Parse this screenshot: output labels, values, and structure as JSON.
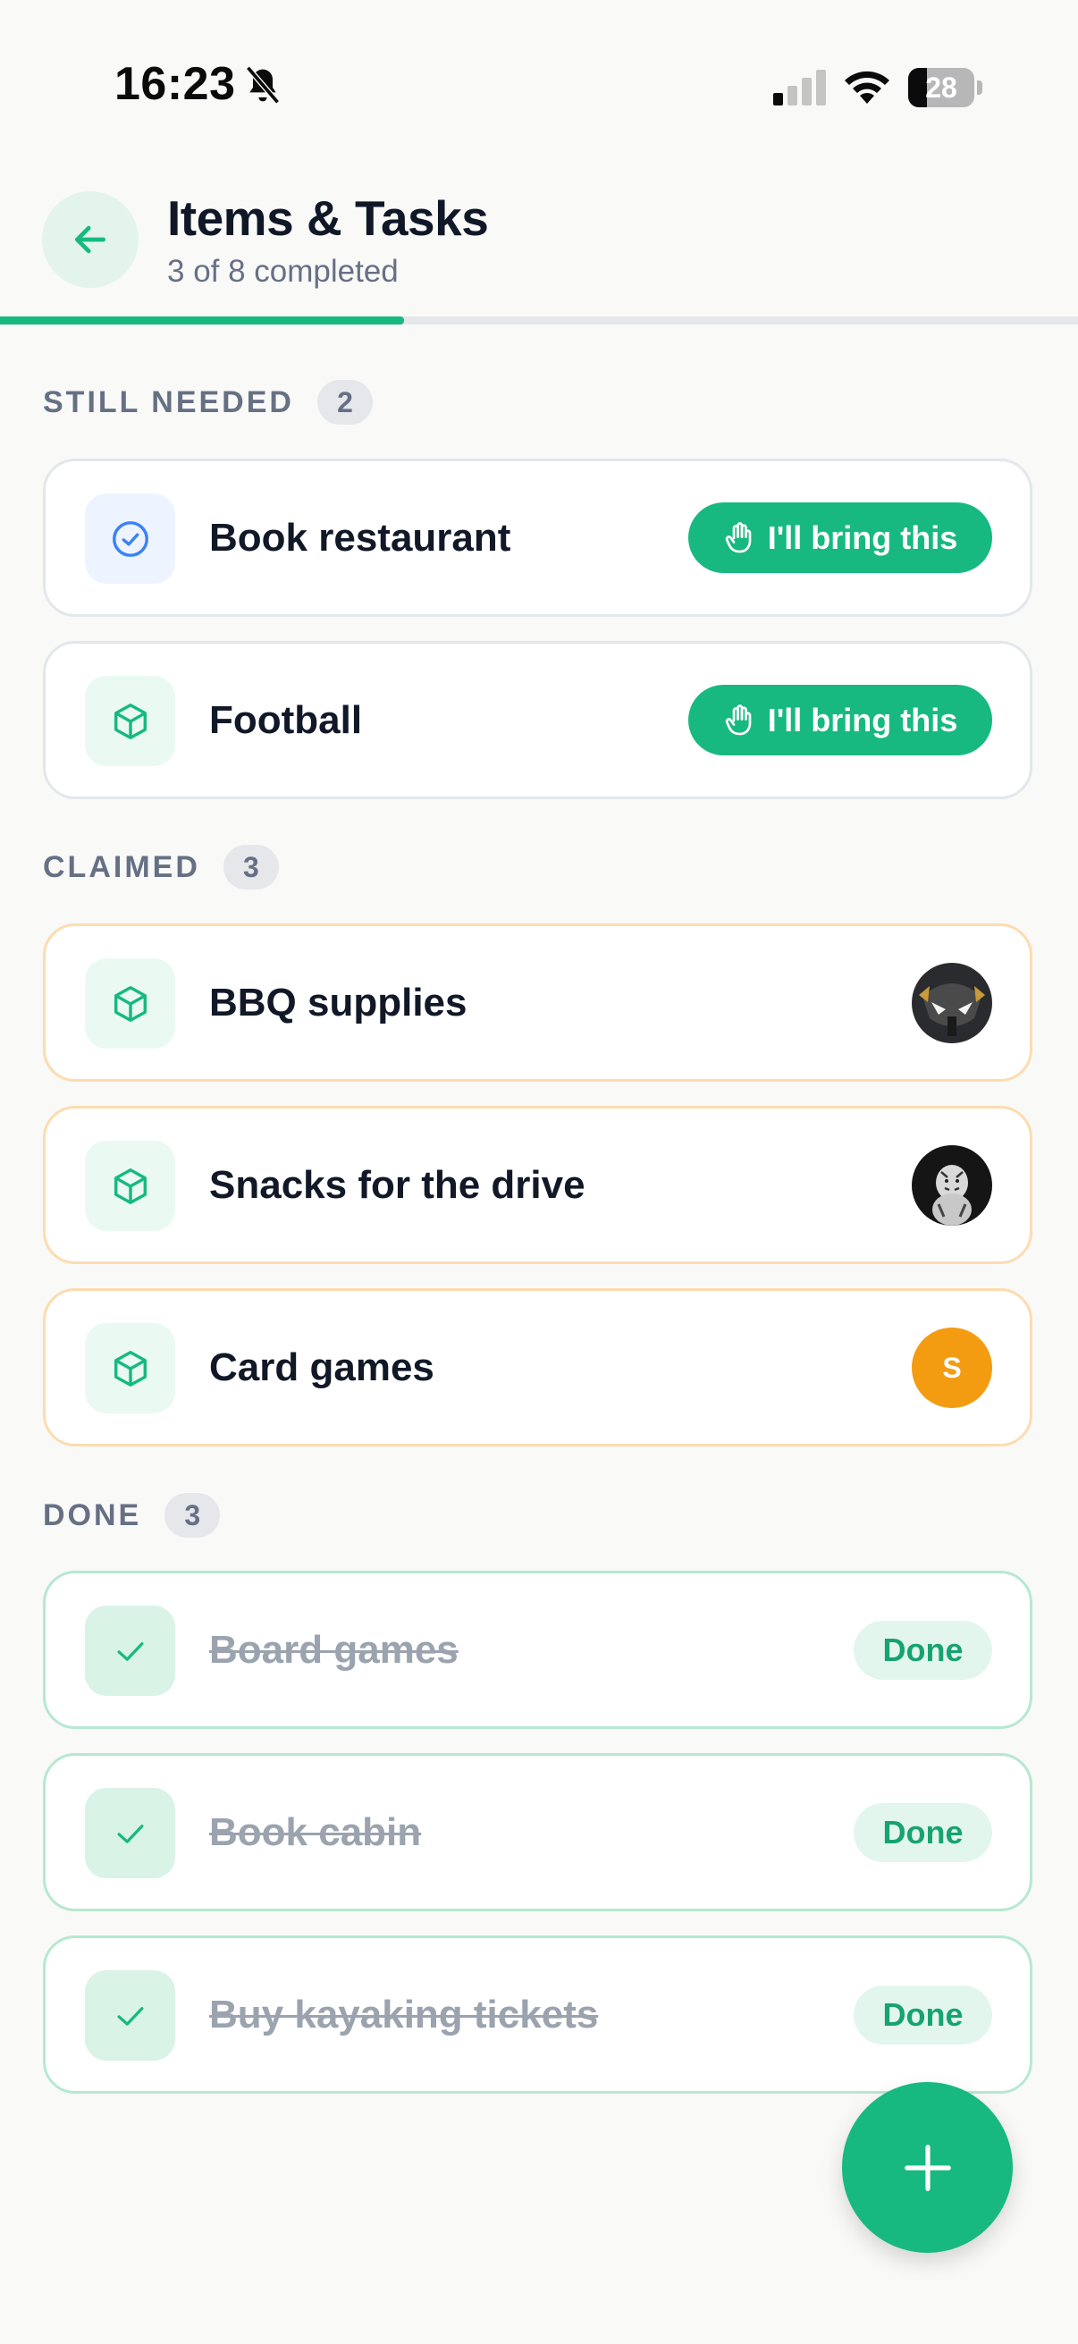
{
  "status_bar": {
    "time": "16:23",
    "battery": "28",
    "battery_level": 0.28
  },
  "header": {
    "title": "Items & Tasks",
    "subtitle": "3 of 8 completed",
    "progress": 0.375
  },
  "sections": {
    "needed": {
      "label": "STILL NEEDED",
      "count": "2"
    },
    "claimed": {
      "label": "CLAIMED",
      "count": "3"
    },
    "done": {
      "label": "DONE",
      "count": "3"
    }
  },
  "items": {
    "needed": [
      {
        "name": "Book restaurant",
        "icon": "check-circle-icon",
        "action": "I'll bring this"
      },
      {
        "name": "Football",
        "icon": "box-icon",
        "action": "I'll bring this"
      }
    ],
    "claimed": [
      {
        "name": "BBQ supplies",
        "icon": "box-icon",
        "avatar": "motorcycle-photo"
      },
      {
        "name": "Snacks for the drive",
        "icon": "box-icon",
        "avatar": "tiger-photo"
      },
      {
        "name": "Card games",
        "icon": "box-icon",
        "avatar_initial": "S"
      }
    ],
    "done": [
      {
        "name": "Board games",
        "icon": "check-icon",
        "status": "Done"
      },
      {
        "name": "Book cabin",
        "icon": "check-icon",
        "status": "Done"
      },
      {
        "name": "Buy kayaking tickets",
        "icon": "check-icon",
        "status": "Done"
      }
    ]
  },
  "colors": {
    "accent": "#17b981",
    "claimed_border": "#fcdcb0",
    "done_border": "#b6e8d2",
    "avatar_initial_bg": "#f39c12"
  }
}
